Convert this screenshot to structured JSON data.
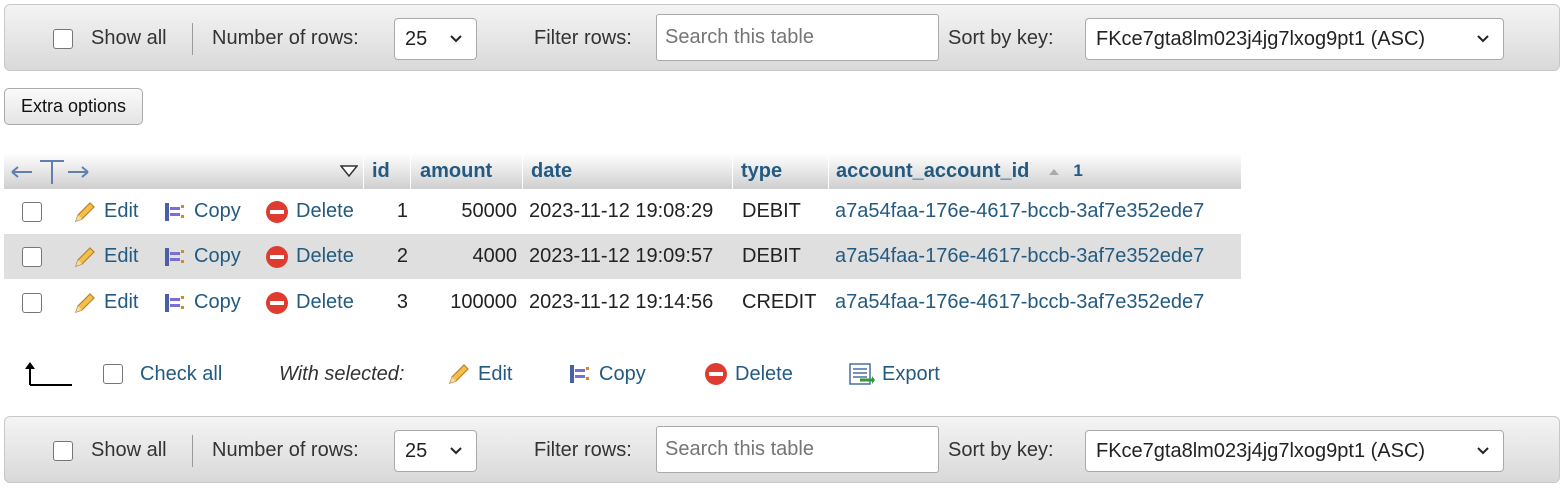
{
  "navbar": {
    "show_all_label": "Show all",
    "rows_label": "Number of rows:",
    "rows_value": "25",
    "filter_label": "Filter rows:",
    "filter_placeholder": "Search this table",
    "sort_label": "Sort by key:",
    "sort_value": "FKce7gta8lm023j4jg7lxog9pt1 (ASC)"
  },
  "extra_options_label": "Extra options",
  "table": {
    "columns": [
      "id",
      "amount",
      "date",
      "type",
      "account_account_id"
    ],
    "sort_indicator": "1",
    "actions": {
      "edit": "Edit",
      "copy": "Copy",
      "delete": "Delete"
    },
    "rows": [
      {
        "id": "1",
        "amount": "50000",
        "date": "2023-11-12 19:08:29",
        "type": "DEBIT",
        "account": "a7a54faa-176e-4617-bccb-3af7e352ede7"
      },
      {
        "id": "2",
        "amount": "4000",
        "date": "2023-11-12 19:09:57",
        "type": "DEBIT",
        "account": "a7a54faa-176e-4617-bccb-3af7e352ede7"
      },
      {
        "id": "3",
        "amount": "100000",
        "date": "2023-11-12 19:14:56",
        "type": "CREDIT",
        "account": "a7a54faa-176e-4617-bccb-3af7e352ede7"
      }
    ]
  },
  "bulk": {
    "check_all": "Check all",
    "with_selected": "With selected:",
    "edit": "Edit",
    "copy": "Copy",
    "delete": "Delete",
    "export": "Export"
  },
  "colors": {
    "link": "#235a81",
    "alt_row": "#dfdfdf",
    "delete_red": "#e03b2f"
  }
}
